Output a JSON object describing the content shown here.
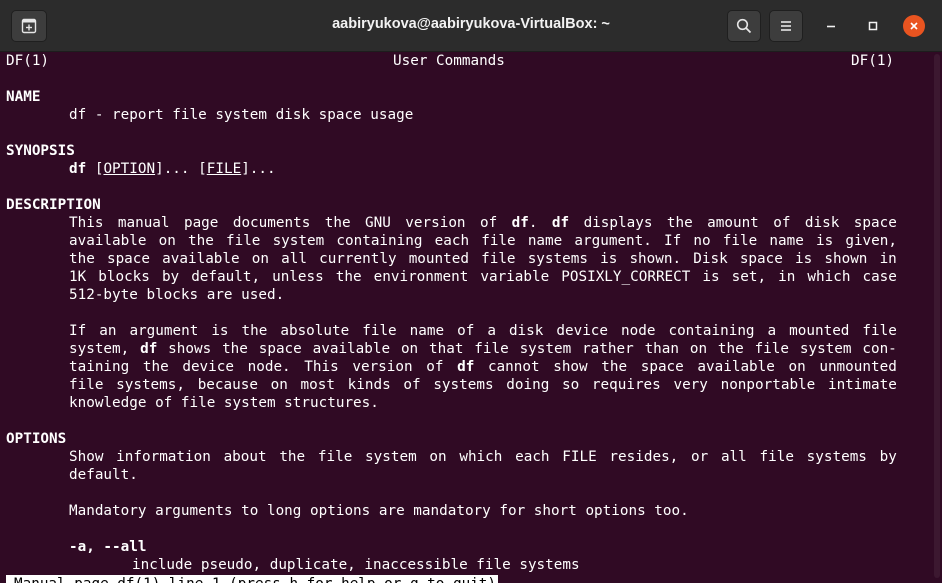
{
  "window": {
    "title": "aabiryukova@aabiryukova-VirtualBox: ~",
    "buttons": {
      "new_tab_icon": "new-tab-icon",
      "search_icon": "search-icon",
      "menu_icon": "hamburger-menu-icon",
      "minimize_icon": "minimize-icon",
      "maximize_icon": "maximize-icon",
      "close_icon": "close-icon"
    },
    "colors": {
      "terminal_bg": "#300a24",
      "titlebar_bg": "#2c2c2c",
      "close_accent": "#e95420"
    }
  },
  "man": {
    "header_left": "DF(1)",
    "header_center": "User Commands",
    "header_right": "DF(1)",
    "name_heading": "NAME",
    "name_text": "df - report file system disk space usage",
    "synopsis_heading": "SYNOPSIS",
    "synopsis_cmd": "df",
    "synopsis_sp1": " [",
    "synopsis_option": "OPTION",
    "synopsis_mid": "]... [",
    "synopsis_file": "FILE",
    "synopsis_end": "]...",
    "description_heading": "DESCRIPTION",
    "desc_p1": [
      [
        "This",
        "manual",
        "page",
        "documents",
        "the",
        "GNU",
        "version",
        "of",
        "df.",
        "df",
        "displays",
        "the",
        "amount",
        "of",
        "disk",
        "space"
      ],
      [
        "available",
        "on",
        "the",
        "file",
        "system",
        "containing",
        "each",
        "file",
        "name",
        "argument.",
        "If",
        "no",
        "file",
        "name",
        "is",
        "given,"
      ],
      [
        "the",
        "space",
        "available",
        "on",
        "all",
        "currently",
        "mounted",
        "file",
        "systems",
        "is",
        "shown.",
        "Disk",
        "space",
        "is",
        "shown",
        "in"
      ],
      [
        "1K",
        "blocks",
        "by",
        "default,",
        "unless",
        "the",
        "environment",
        "variable",
        "POSIXLY_CORRECT",
        "is",
        "set,",
        "in",
        "which",
        "case"
      ],
      [
        "512-byte blocks are used."
      ]
    ],
    "desc_p2": [
      [
        "If",
        "an",
        "argument",
        "is",
        "the",
        "absolute",
        "file",
        "name",
        "of",
        "a",
        "disk",
        "device",
        "node",
        "containing",
        "a",
        "mounted",
        "file"
      ],
      [
        "system,",
        "df",
        "shows",
        "the",
        "space",
        "available",
        "on",
        "that",
        "file",
        "system",
        "rather",
        "than",
        "on",
        "the",
        "file",
        "system",
        "con-"
      ],
      [
        "taining",
        "the",
        "device",
        "node.",
        "This",
        "version",
        "of",
        "df",
        "cannot",
        "show",
        "the",
        "space",
        "available",
        "on",
        "unmounted"
      ],
      [
        "file",
        "systems,",
        "because",
        "on",
        "most",
        "kinds",
        "of",
        "systems",
        "doing",
        "so",
        "requires",
        "very",
        "nonportable",
        "intimate"
      ],
      [
        "knowledge of file system structures."
      ]
    ],
    "options_heading": "OPTIONS",
    "opt_p1": [
      [
        "Show",
        "information",
        "about",
        "the",
        "file",
        "system",
        "on",
        "which",
        "each",
        "FILE",
        "resides,",
        "or",
        "all",
        "file",
        "systems",
        "by"
      ],
      [
        "default."
      ]
    ],
    "opt_p2": "Mandatory arguments to long options are mandatory for short options too.",
    "opt_a_flag": "-a, --all",
    "opt_a_desc": "include pseudo, duplicate, inaccessible file systems",
    "status": "Manual page df(1) line 1 (press h for help or q to quit)"
  }
}
